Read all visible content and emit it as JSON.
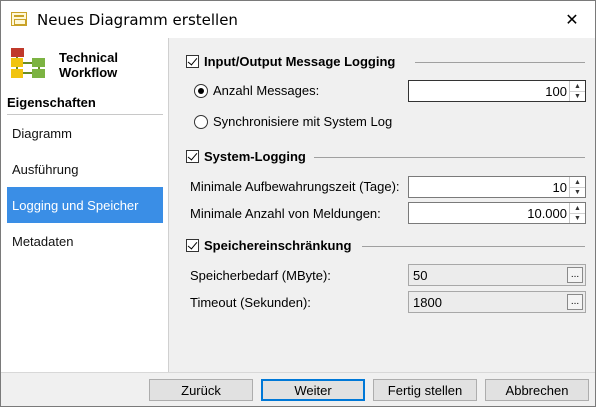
{
  "window": {
    "title": "Neues Diagramm erstellen",
    "close_icon": "close-icon"
  },
  "sidebar": {
    "brand_line1": "Technical",
    "brand_line2": "Workflow",
    "heading": "Eigenschaften",
    "items": [
      {
        "label": "Diagramm",
        "active": false
      },
      {
        "label": "Ausführung",
        "active": false
      },
      {
        "label": "Logging und Speicher",
        "active": true
      },
      {
        "label": "Metadaten",
        "active": false
      }
    ]
  },
  "io_logging": {
    "title": "Input/Output Message Logging",
    "checked": true,
    "option_count_label": "Anzahl Messages:",
    "option_count_value": "100",
    "option_sync_label": "Synchronisiere mit System Log"
  },
  "system_logging": {
    "title": "System-Logging",
    "checked": true,
    "retention_label": "Minimale Aufbewahrungszeit (Tage):",
    "retention_value": "10",
    "min_messages_label": "Minimale Anzahl von Meldungen:",
    "min_messages_value": "10.000"
  },
  "storage": {
    "title": "Speichereinschränkung",
    "checked": true,
    "memory_label": "Speicherbedarf (MByte):",
    "memory_value": "50",
    "timeout_label": "Timeout (Sekunden):",
    "timeout_value": "1800",
    "browse_label": "..."
  },
  "footer": {
    "back": "Zurück",
    "next": "Weiter",
    "finish": "Fertig stellen",
    "cancel": "Abbrechen"
  },
  "colors": {
    "accent": "#3a8ee6",
    "focus": "#0078d7"
  }
}
